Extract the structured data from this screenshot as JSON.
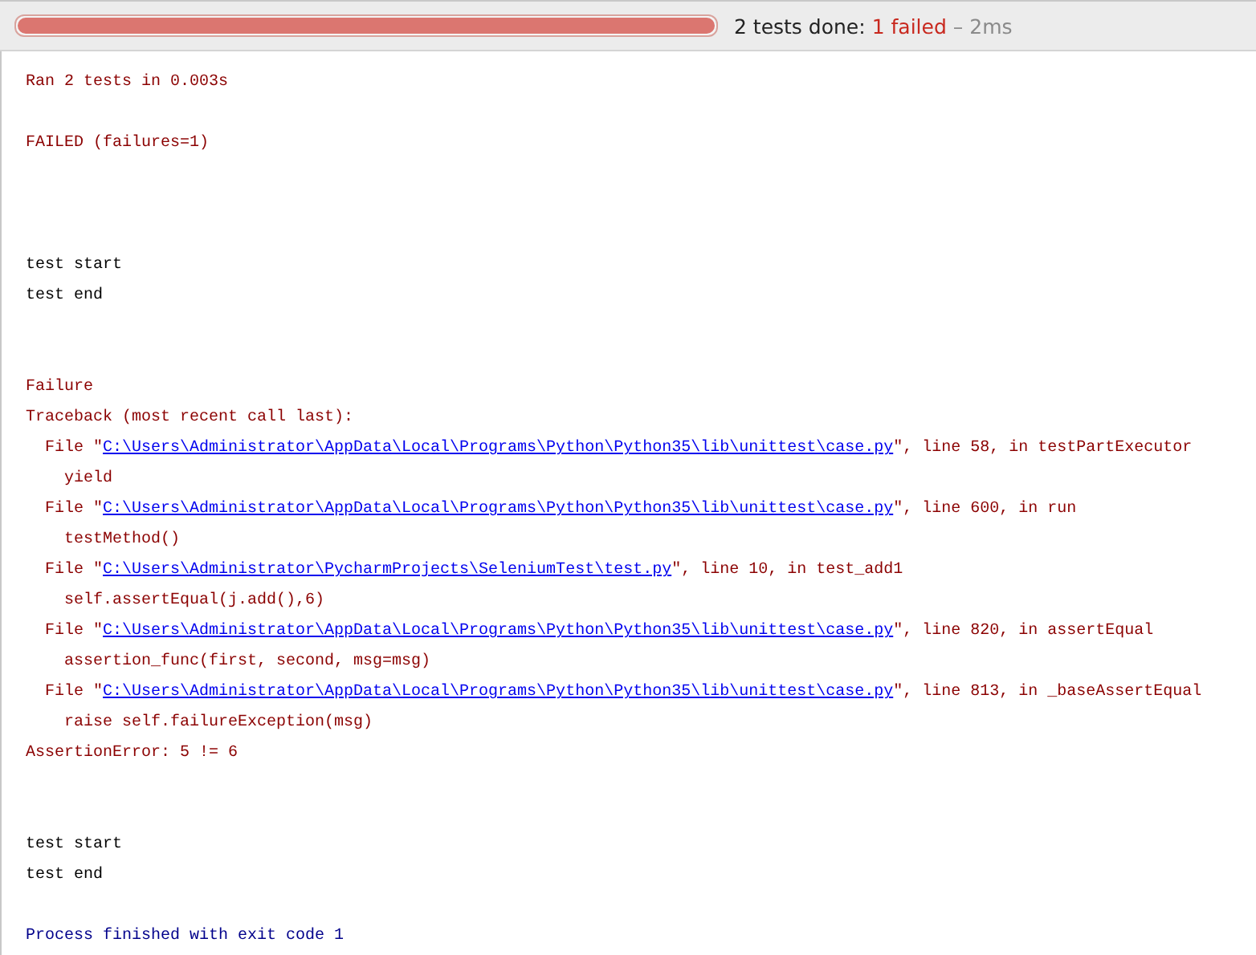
{
  "status_bar": {
    "progress": {
      "level": 1,
      "failed": true
    },
    "summary": "2 tests done:",
    "failed_count": "1 failed",
    "duration": "– 2ms"
  },
  "console": [
    {
      "kind": "error",
      "text": "Ran 2 tests in 0.003s"
    },
    {
      "kind": "blank"
    },
    {
      "kind": "error",
      "text": "FAILED (failures=1)"
    },
    {
      "kind": "blank"
    },
    {
      "kind": "blank"
    },
    {
      "kind": "blank"
    },
    {
      "kind": "output",
      "text": "test start"
    },
    {
      "kind": "output",
      "text": "test end"
    },
    {
      "kind": "blank"
    },
    {
      "kind": "blank"
    },
    {
      "kind": "error",
      "text": "Failure"
    },
    {
      "kind": "error",
      "text": "Traceback (most recent call last):"
    },
    {
      "kind": "file",
      "prefix": "File \"",
      "path": "C:\\Users\\Administrator\\AppData\\Local\\Programs\\Python\\Python35\\lib\\unittest\\case.py",
      "suffix": "\", line 58, in testPartExecutor"
    },
    {
      "kind": "code",
      "text": "yield"
    },
    {
      "kind": "file",
      "prefix": "File \"",
      "path": "C:\\Users\\Administrator\\AppData\\Local\\Programs\\Python\\Python35\\lib\\unittest\\case.py",
      "suffix": "\", line 600, in run"
    },
    {
      "kind": "code",
      "text": "testMethod()"
    },
    {
      "kind": "file",
      "prefix": "File \"",
      "path": "C:\\Users\\Administrator\\PycharmProjects\\SeleniumTest\\test.py",
      "suffix": "\", line 10, in test_add1"
    },
    {
      "kind": "code",
      "text": "self.assertEqual(j.add(),6)"
    },
    {
      "kind": "file",
      "prefix": "File \"",
      "path": "C:\\Users\\Administrator\\AppData\\Local\\Programs\\Python\\Python35\\lib\\unittest\\case.py",
      "suffix": "\", line 820, in assertEqual"
    },
    {
      "kind": "code",
      "text": "assertion_func(first, second, msg=msg)"
    },
    {
      "kind": "file",
      "prefix": "File \"",
      "path": "C:\\Users\\Administrator\\AppData\\Local\\Programs\\Python\\Python35\\lib\\unittest\\case.py",
      "suffix": "\", line 813, in _baseAssertEqual"
    },
    {
      "kind": "code",
      "text": "raise self.failureException(msg)"
    },
    {
      "kind": "error",
      "text": "AssertionError: 5 != 6"
    },
    {
      "kind": "blank"
    },
    {
      "kind": "blank"
    },
    {
      "kind": "output",
      "text": "test start"
    },
    {
      "kind": "output",
      "text": "test end"
    },
    {
      "kind": "blank"
    },
    {
      "kind": "system",
      "text": "Process finished with exit code 1"
    }
  ]
}
